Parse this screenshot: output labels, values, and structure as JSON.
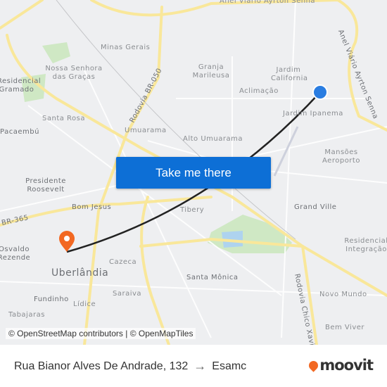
{
  "map": {
    "labels": [
      "Anel Viário Ayrton Senna",
      "Minas Gerais",
      "Nossa Senhora das Graças",
      "Residencial Gramado",
      "Granja Marileusa",
      "Jardim California",
      "Aclimação",
      "Jardim Ipanema",
      "Anel Viário Ayrton Senna",
      "Santa Rosa",
      "Pacaembú",
      "Rodovia BR-050",
      "Umuarama",
      "Alto Umuarama",
      "Mansões Aeroporto",
      "Presidente Roosevelt",
      "Bom Jesus",
      "Tibery",
      "Grand Ville",
      "BR-365",
      "Residencial Integração",
      "Osvaldo Rezende",
      "Cazeca",
      "Uberlândia",
      "Santa Mônica",
      "Saraiva",
      "Fundinho",
      "Lídice",
      "Tabajaras",
      "Rodovia Chico Xavier",
      "Novo Mundo",
      "Bem Viver"
    ],
    "origin_marker_color": "#2a7de1",
    "destination_marker_color": "#f26822",
    "route_color": "#222222"
  },
  "cta": {
    "label": "Take me there"
  },
  "attribution": "© OpenStreetMap contributors | © OpenMapTiles",
  "footer": {
    "origin": "Rua Bianor Alves De Andrade, 132",
    "arrow": "→",
    "destination": "Esamc",
    "brand": "moovit"
  }
}
